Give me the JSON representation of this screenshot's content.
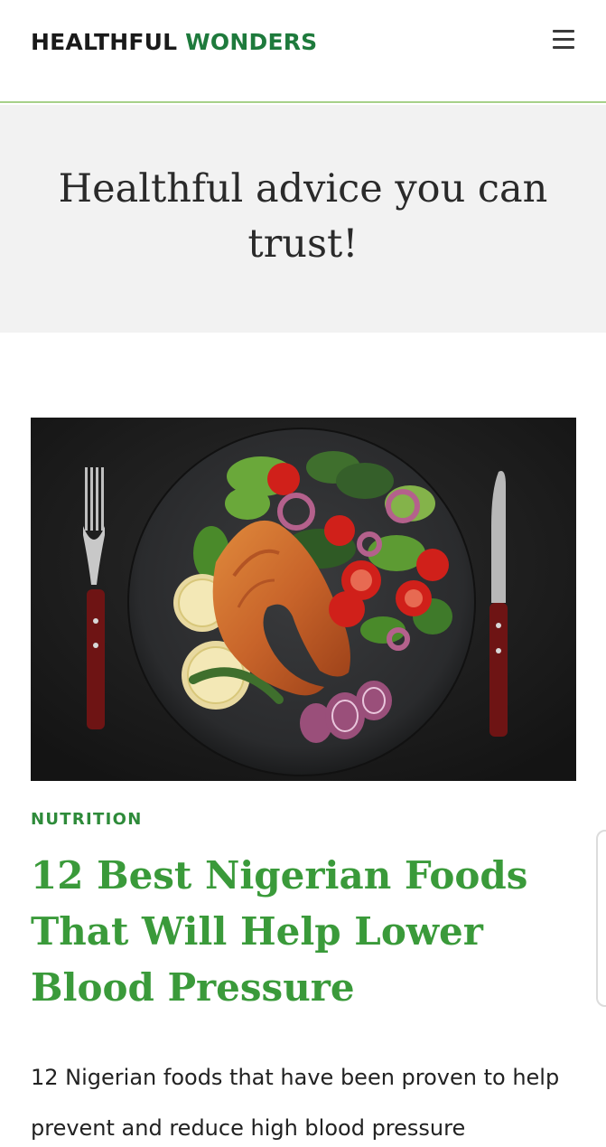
{
  "header": {
    "logo_word1": "HEALTHFUL",
    "logo_word2": "WONDERS",
    "menu_icon": "hamburger-menu-icon"
  },
  "hero": {
    "tagline": "Healthful advice you can trust!"
  },
  "article": {
    "category": "NUTRITION",
    "title": "12 Best Nigerian Foods That Will Help Lower Blood Pressure",
    "excerpt": "12 Nigerian foods that have been proven to help prevent and reduce high blood pressure"
  },
  "colors": {
    "brand_green": "#1e7a3c",
    "headline_green": "#3a9a3a",
    "category_green": "#2e8b3a",
    "header_border": "#a7d18a",
    "band_gray": "#f2f2f2"
  }
}
